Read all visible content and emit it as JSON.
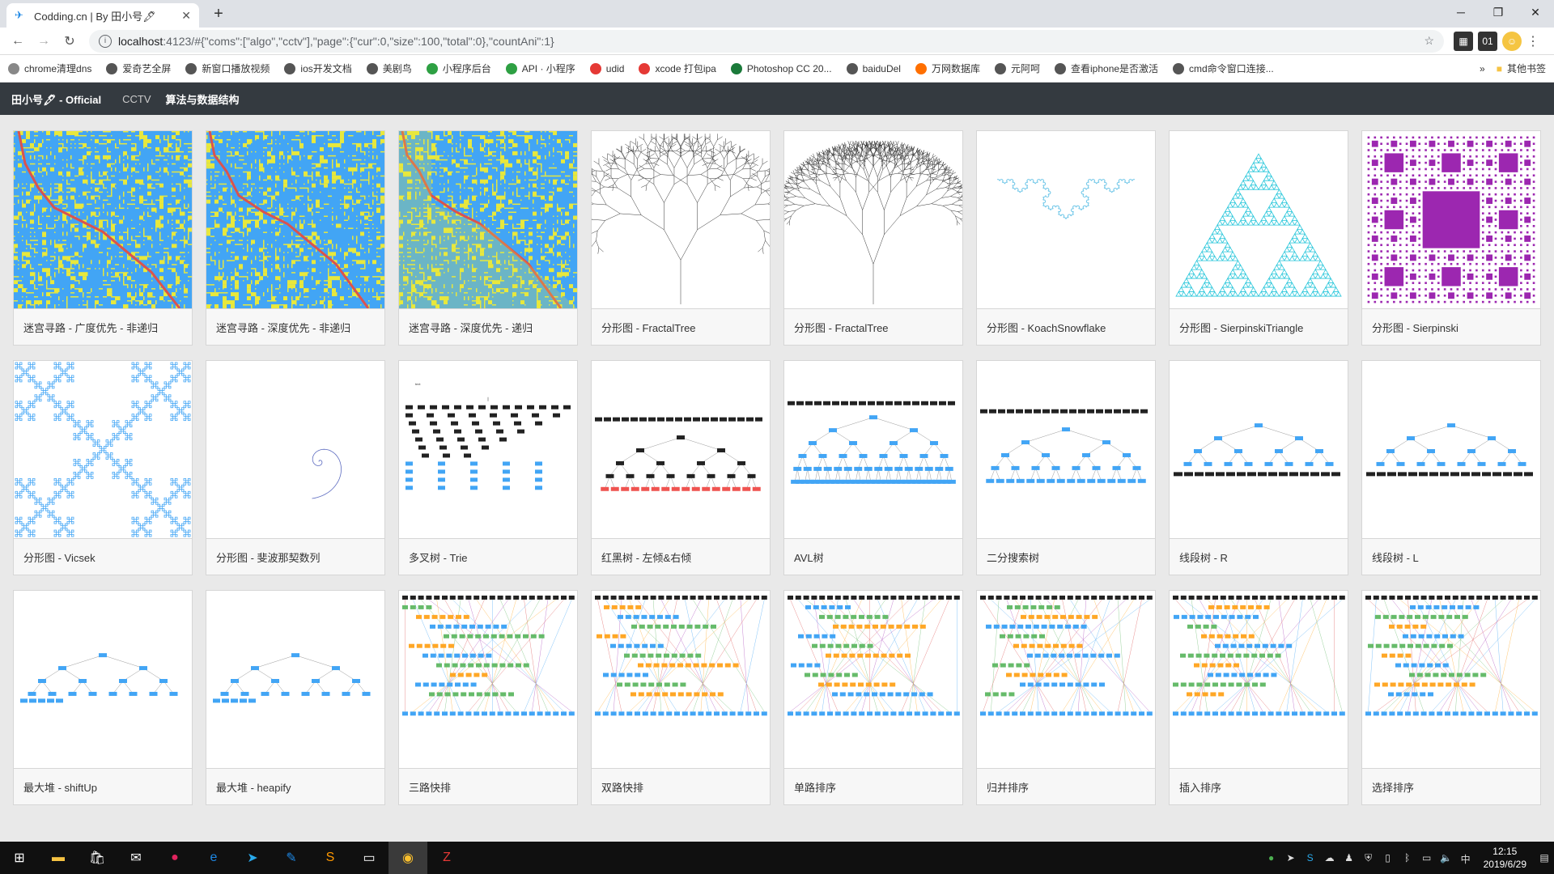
{
  "browser": {
    "tab_title": "Codding.cn | By 田小号🖋",
    "new_tab": "+",
    "url_host": "localhost",
    "url_rest": ":4123/#{\"coms\":[\"algo\",\"cctv\"],\"page\":{\"cur\":0,\"size\":100,\"total\":0},\"countAni\":1}",
    "bookmarks": [
      "chrome清理dns",
      "爱奇艺全屏",
      "新窗口播放视频",
      "ios开发文档",
      "美剧鸟",
      "小程序后台",
      "API · 小程序",
      "udid",
      "xcode 打包ipa",
      "Photoshop CC 20...",
      "baiduDel",
      "万网数据库",
      "元阿呵",
      "查看iphone是否激活",
      "cmd命令窗口连接..."
    ],
    "bookmarks_other": "其他书签"
  },
  "app": {
    "brand": "田小号🖋 - Official",
    "nav": [
      "CCTV",
      "算法与数据结构"
    ]
  },
  "cards": [
    "迷宫寻路 - 广度优先 - 非递归",
    "迷宫寻路 - 深度优先 - 非递归",
    "迷宫寻路 - 深度优先 - 递归",
    "分形图 - FractalTree",
    "分形图 - FractalTree",
    "分形图 - KoachSnowflake",
    "分形图 - SierpinskiTriangle",
    "分形图 - Sierpinski",
    "分形图 - Vicsek",
    "分形图 - 斐波那契数列",
    "多叉树 - Trie",
    "红黑树 - 左倾&右倾",
    "AVL树",
    "二分搜索树",
    "线段树 - R",
    "线段树 - L",
    "最大堆 - shiftUp",
    "最大堆 - heapify",
    "三路快排",
    "双路快排",
    "单路排序",
    "归并排序",
    "插入排序",
    "选择排序"
  ],
  "taskbar": {
    "ime": "中",
    "time": "12:15",
    "date": "2019/6/29"
  },
  "colors": {
    "maze_bg": "#42a5f5",
    "maze_wall": "#e8e83c",
    "maze_path": "#d9534f",
    "koch": "#6ec6e8",
    "triangle": "#26c6da",
    "carpet": "#9c27b0",
    "vicsek": "#42a5f5",
    "node_blue": "#42a5f5",
    "node_green": "#66bb6a",
    "node_orange": "#ffa726",
    "node_black": "#222222",
    "node_red": "#ef5350",
    "app_nav": "#343a40"
  }
}
